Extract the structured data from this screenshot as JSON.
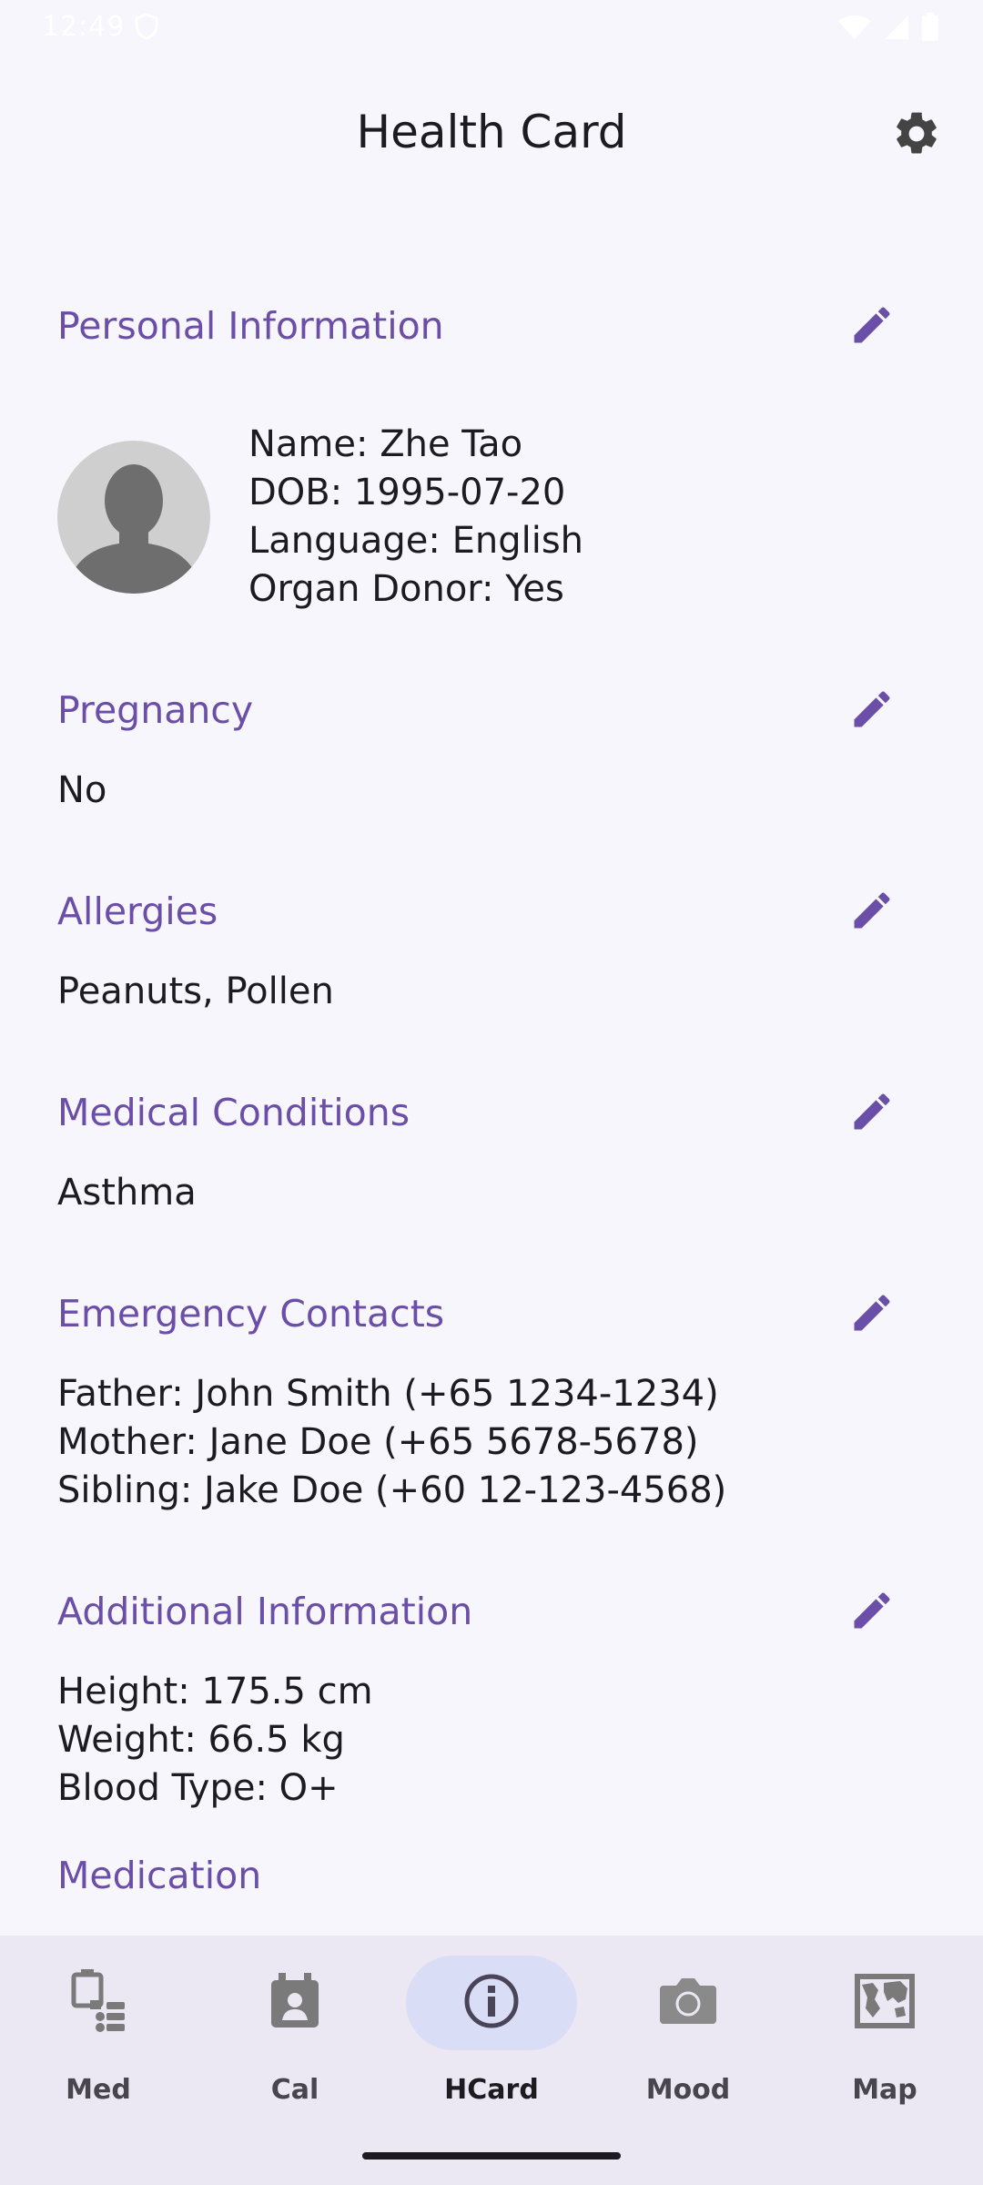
{
  "status_bar": {
    "time": "12:49"
  },
  "header": {
    "title": "Health Card"
  },
  "personal": {
    "title": "Personal Information",
    "lines": [
      "Name: Zhe Tao",
      "DOB: 1995-07-20",
      "Language: English",
      "Organ Donor: Yes"
    ]
  },
  "pregnancy": {
    "title": "Pregnancy",
    "lines": [
      "No"
    ]
  },
  "allergies": {
    "title": "Allergies",
    "lines": [
      "Peanuts, Pollen"
    ]
  },
  "conditions": {
    "title": "Medical Conditions",
    "lines": [
      "Asthma"
    ]
  },
  "contacts": {
    "title": "Emergency Contacts",
    "lines": [
      "Father: John Smith (+65 1234-1234)",
      "Mother: Jane Doe (+65 5678-5678)",
      "Sibling: Jake Doe (+60 12-123-4568)"
    ]
  },
  "additional": {
    "title": "Additional Information",
    "lines": [
      "Height: 175.5 cm",
      "Weight: 66.5 kg",
      "Blood Type: O+"
    ]
  },
  "medication": {
    "title": "Medication"
  },
  "nav": {
    "items": [
      {
        "label": "Med",
        "icon": "medication-list-icon"
      },
      {
        "label": "Cal",
        "icon": "calendar-icon"
      },
      {
        "label": "HCard",
        "icon": "info-icon",
        "active": true
      },
      {
        "label": "Mood",
        "icon": "camera-icon"
      },
      {
        "label": "Map",
        "icon": "map-icon"
      }
    ]
  },
  "colors": {
    "accent": "#6a4ea8",
    "background": "#f7f6fc",
    "nav_background": "#ebe8f4",
    "nav_active": "#d9def6"
  }
}
